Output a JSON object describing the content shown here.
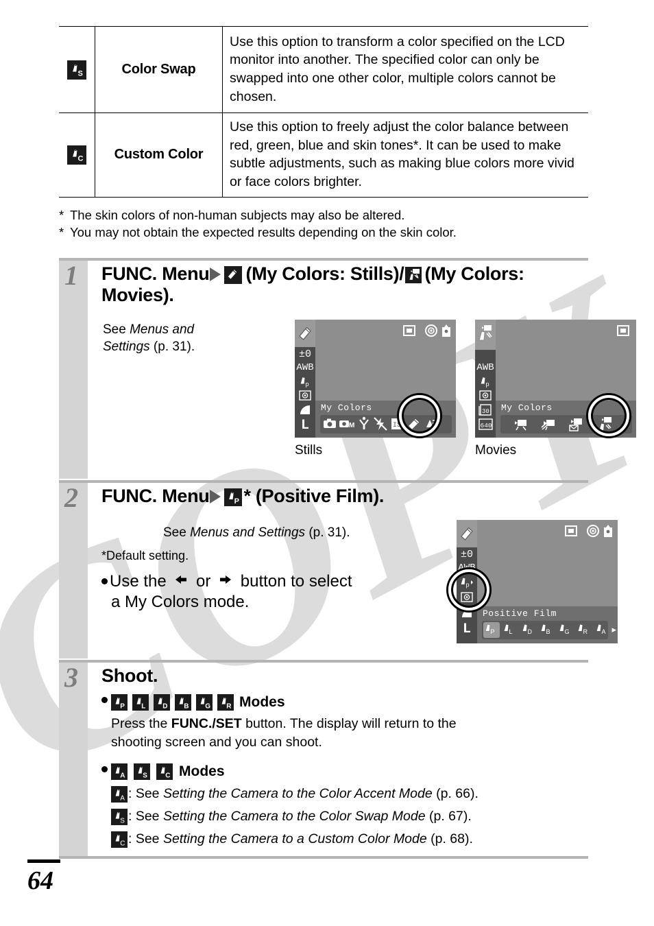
{
  "page_number": "64",
  "table": {
    "rows": [
      {
        "icon": "my-colors-color-swap-icon",
        "icon_sub": "S",
        "name": "Color Swap",
        "description": "Use this option to transform a color specified on the LCD monitor into another. The specified color can only be swapped into one other color, multiple colors cannot be chosen."
      },
      {
        "icon": "my-colors-custom-color-icon",
        "icon_sub": "C",
        "name": "Custom Color",
        "description": "Use this option to freely adjust the color balance between red, green, blue and skin tones*. It can be used to make subtle adjustments, such as making blue colors more vivid or face colors brighter."
      }
    ]
  },
  "footnotes": [
    {
      "marker": "*",
      "text": "The skin colors of non-human subjects may also be altered."
    },
    {
      "marker": "*",
      "text": "You may not obtain the expected results depending on the skin color."
    }
  ],
  "steps": [
    {
      "number": "1",
      "heading_part1": "FUNC. Menu",
      "heading_part2": "(My Colors: Stills)/",
      "heading_part3": "(My Colors: Movies).",
      "see_text_1": "See ",
      "see_text_italic": "Menus and Settings",
      "see_text_2": " (p. 31).",
      "screens": [
        {
          "caption": "Stills",
          "menu_title": "My Colors",
          "side_icons": [
            "my-colors-icon",
            "±0",
            "AWB",
            "my-colors-p-icon",
            "metering-icon",
            "compression-icon",
            "L"
          ],
          "top_icons": [
            "drive-single-icon",
            "red-eye-icon",
            "flash-auto-icon"
          ],
          "tray_icons": [
            "still-image-icon",
            "continuous-icon",
            "self-timer-icon",
            "flash-off-icon",
            "iso-icon",
            "my-colors-icon",
            "stitch-icon"
          ],
          "tray_selected_index": 5
        },
        {
          "caption": "Movies",
          "menu_title": "My Colors",
          "side_icons": [
            "movie-my-colors-icon",
            "AWB",
            "my-colors-p-icon",
            "metering-icon",
            "30",
            "640"
          ],
          "top_icons": [
            "drive-single-icon"
          ],
          "tray_icons": [
            "movie-standard-icon",
            "movie-fast-icon",
            "movie-compact-icon",
            "movie-my-colors-icon"
          ],
          "tray_selected_index": 3
        }
      ]
    },
    {
      "number": "2",
      "heading_part1": "FUNC. Menu",
      "heading_suffix": "* (Positive Film).",
      "see_text_1": "See ",
      "see_text_italic": "Menus and Settings",
      "see_text_2": " (p. 31).",
      "default_note": "*Default setting.",
      "bullet_line1_a": "Use the ",
      "bullet_line1_b": " or ",
      "bullet_line1_c": " button to select",
      "bullet_line2": "a My Colors mode.",
      "screen": {
        "menu_title": "Positive Film",
        "side_icons": [
          "my-colors-icon",
          "±0",
          "AWB",
          "my-colors-p-icon",
          "metering-icon",
          "compression-icon",
          "L"
        ],
        "top_icons": [
          "drive-single-icon",
          "red-eye-icon",
          "flash-auto-icon"
        ],
        "tray_labels": [
          "P",
          "L",
          "D",
          "B",
          "G",
          "R",
          "A"
        ],
        "tray_selected_index": 0,
        "more_arrow": "▸"
      }
    },
    {
      "number": "3",
      "heading": "Shoot.",
      "group1_modes": [
        "P",
        "L",
        "D",
        "B",
        "G",
        "R"
      ],
      "group1_label": "Modes",
      "group1_text_a": "Press the ",
      "group1_text_b": "FUNC./SET",
      "group1_text_c": " button. The display will return to the",
      "group1_text_line2": "shooting screen and you can shoot.",
      "group2_modes": [
        "A",
        "S",
        "C"
      ],
      "group2_label": "Modes",
      "refs": [
        {
          "mode": "A",
          "pre": ": See ",
          "italic": "Setting the Camera to the Color Accent Mode",
          "post": " (p. 66)."
        },
        {
          "mode": "S",
          "pre": ": See ",
          "italic": "Setting the Camera to the Color Swap Mode",
          "post": " (p. 67)."
        },
        {
          "mode": "C",
          "pre": ": See ",
          "italic": "Setting the Camera to a Custom Color Mode",
          "post": " (p. 68)."
        }
      ]
    }
  ],
  "watermark": {
    "text": "COPY",
    "color": "#dcdcdc"
  },
  "colors": {
    "rule": "#b4b4b4",
    "gutter": "#d4d4d4",
    "step_number": "#7d7d7d",
    "lcd_bg": "#8e8e8e",
    "lcd_side": "#4a4a4a",
    "lcd_bottom": "#6f6f6f",
    "badge_bg": "#1b1b1b"
  }
}
